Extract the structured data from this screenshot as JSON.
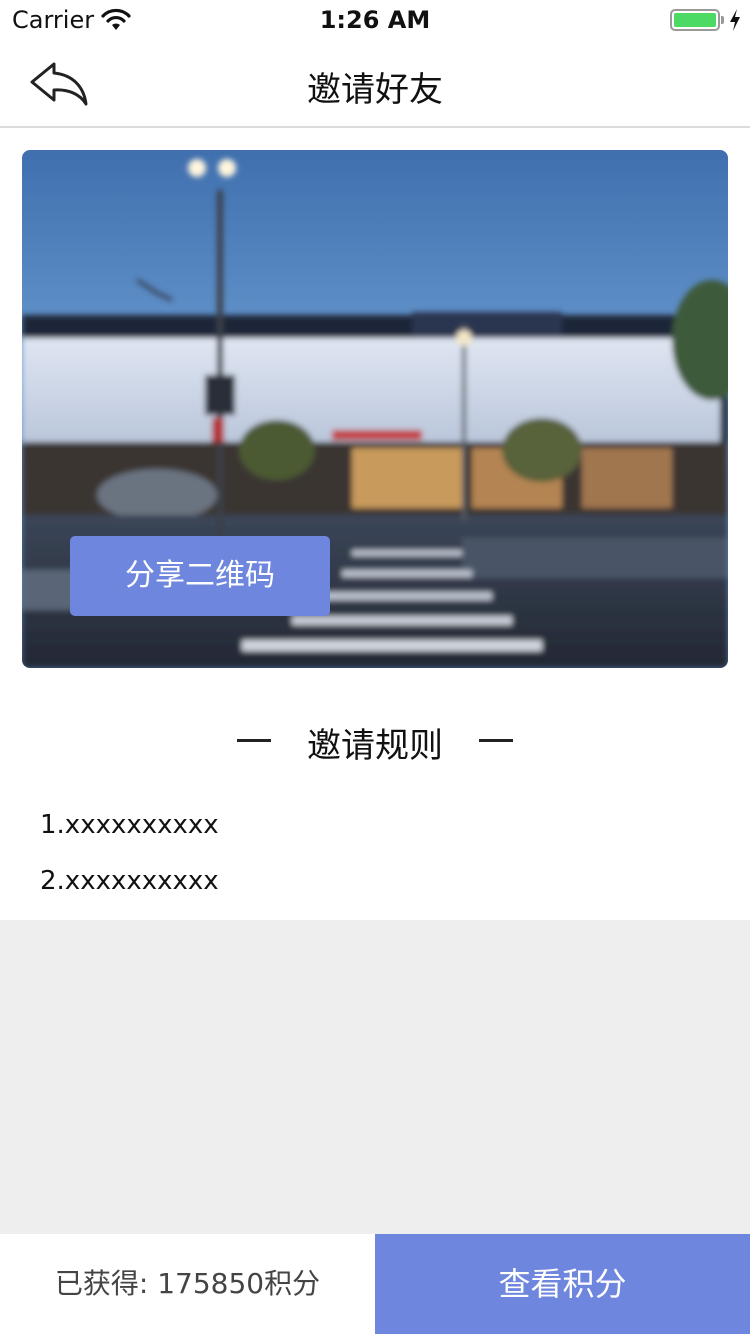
{
  "status_bar": {
    "carrier": "Carrier",
    "time": "1:26 AM",
    "battery_level": 1.0
  },
  "nav": {
    "title": "邀请好友",
    "back_icon": "back-arrow-icon"
  },
  "banner": {
    "image": "blurred-storefront-photo",
    "share_button_label": "分享二维码"
  },
  "rules": {
    "title": "邀请规则",
    "items": [
      "1.xxxxxxxxxx",
      "2.xxxxxxxxxx"
    ]
  },
  "footer": {
    "points_text": "已获得: 175850积分",
    "view_points_label": "查看积分"
  },
  "colors": {
    "accent": "#6e86dd",
    "gray_background": "#eeeeee",
    "battery_green": "#4cd964"
  }
}
